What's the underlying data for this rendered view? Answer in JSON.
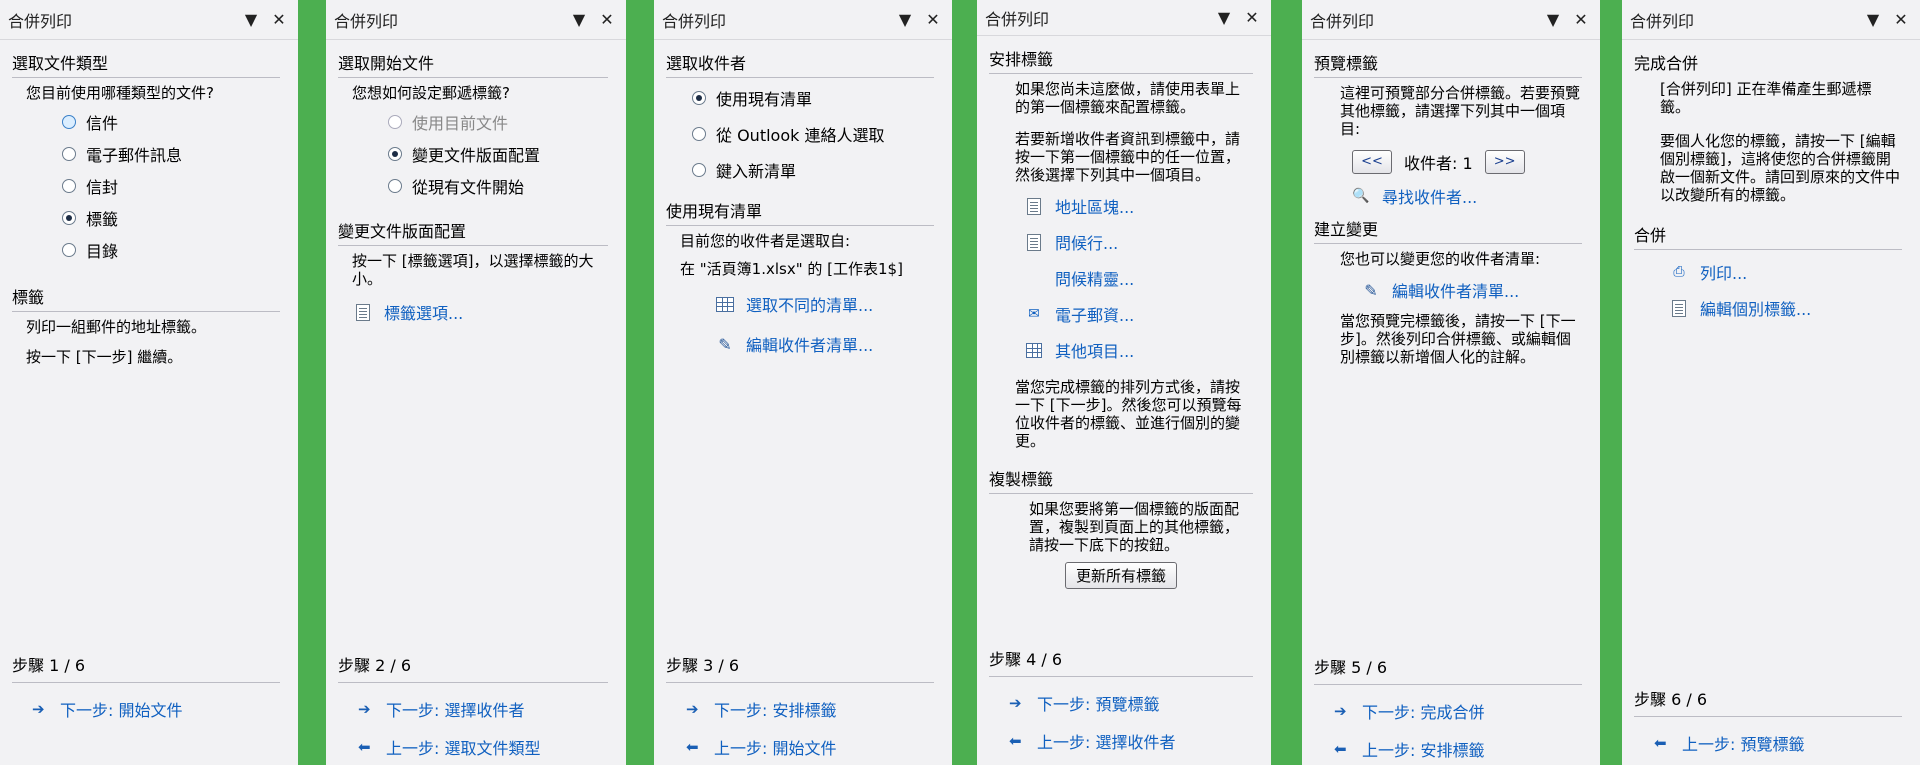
{
  "pane_title": "合併列印",
  "panels": [
    {
      "section1": {
        "title": "選取文件類型",
        "question": "您目前使用哪種類型的文件?",
        "options": [
          "信件",
          "電子郵件訊息",
          "信封",
          "標籤",
          "目錄"
        ]
      },
      "section2": {
        "title": "標籤",
        "line1": "列印一組郵件的地址標籤。",
        "line2": "按一下 [下一步] 繼續。"
      },
      "step": "步驟 1 / 6",
      "next": "下一步: 開始文件"
    },
    {
      "section1": {
        "title": "選取開始文件",
        "question": "您想如何設定郵遞標籤?",
        "options": [
          "使用目前文件",
          "變更文件版面配置",
          "從現有文件開始"
        ]
      },
      "section2": {
        "title": "變更文件版面配置",
        "text": "按一下 [標籤選項]，以選擇標籤的大小。",
        "link": "標籤選項..."
      },
      "step": "步驟 2 / 6",
      "next": "下一步: 選擇收件者",
      "prev": "上一步: 選取文件類型"
    },
    {
      "section1": {
        "title": "選取收件者",
        "options": [
          "使用現有清單",
          "從 Outlook 連絡人選取",
          "鍵入新清單"
        ]
      },
      "section2": {
        "title": "使用現有清單",
        "line1": "目前您的收件者是選取自:",
        "line2": "在 \"活頁簿1.xlsx\" 的 [工作表1$]",
        "link1": "選取不同的清單...",
        "link2": "編輯收件者清單..."
      },
      "step": "步驟 3 / 6",
      "next": "下一步: 安排標籤",
      "prev": "上一步: 開始文件"
    },
    {
      "section1": {
        "title": "安排標籤",
        "para1": "如果您尚未這麼做，請使用表單上的第一個標籤來配置標籤。",
        "para2": "若要新增收件者資訊到標籤中，請按一下第一個標籤中的任一位置，然後選擇下列其中一個項目。",
        "links": [
          "地址區塊...",
          "問候行...",
          "問候精靈...",
          "電子郵資...",
          "其他項目..."
        ],
        "para3": "當您完成標籤的排列方式後，請按一下 [下一步]。然後您可以預覽每位收件者的標籤、並進行個別的變更。"
      },
      "section2": {
        "title": "複製標籤",
        "text": "如果您要將第一個標籤的版面配置，複製到頁面上的其他標籤，請按一下底下的按鈕。",
        "button": "更新所有標籤"
      },
      "step": "步驟 4 / 6",
      "next": "下一步: 預覽標籤",
      "prev": "上一步: 選擇收件者"
    },
    {
      "section1": {
        "title": "預覽標籤",
        "text": "這裡可預覽部分合併標籤。若要預覽其他標籤，請選擇下列其中一個項目:",
        "prev_btn": "<<",
        "next_btn": ">>",
        "recipient": "收件者: 1",
        "find": "尋找收件者..."
      },
      "section2": {
        "title": "建立變更",
        "text": "您也可以變更您的收件者清單:",
        "link": "編輯收件者清單...",
        "text2": "當您預覽完標籤後，請按一下 [下一步]。然後列印合併標籤、或編輯個別標籤以新增個人化的註解。"
      },
      "step": "步驟 5 / 6",
      "next": "下一步: 完成合併",
      "prev": "上一步: 安排標籤"
    },
    {
      "section1": {
        "title": "完成合併",
        "text": "[合併列印] 正在準備產生郵遞標籤。",
        "text2": "要個人化您的標籤，請按一下 [編輯個別標籤]，這將使您的合併標籤開啟一個新文件。請回到原來的文件中以改變所有的標籤。"
      },
      "section2": {
        "title": "合併",
        "link1": "列印...",
        "link2": "編輯個別標籤..."
      },
      "step": "步驟 6 / 6",
      "prev": "上一步: 預覽標籤"
    }
  ]
}
